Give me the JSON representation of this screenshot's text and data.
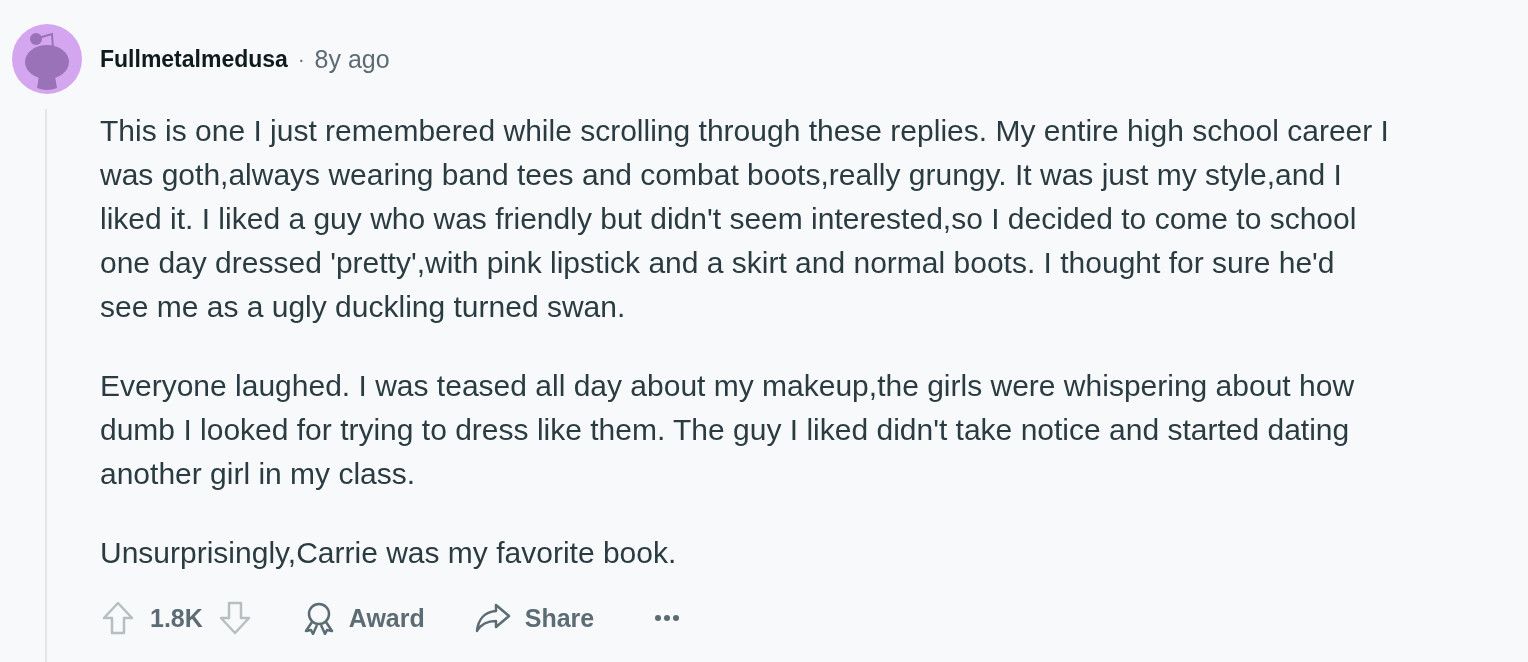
{
  "comment": {
    "author": "Fullmetalmedusa",
    "separator": "·",
    "age": "8y ago",
    "paragraphs": [
      "This is one I just remembered while scrolling through these replies. My entire high school career I was goth,always wearing band tees and combat boots,really grungy. It was just my style,and I liked it. I liked a guy who was friendly but didn't seem interested,so I decided to come to school one day dressed 'pretty',with pink lipstick and a skirt and normal boots. I thought for sure he'd see me as a ugly duckling turned swan.",
      "Everyone laughed. I was teased all day about my makeup,the girls were whispering about how dumb I looked for trying to dress like them. The guy I liked didn't take notice and started dating another girl in my class.",
      "Unsurprisingly,Carrie was my favorite book."
    ],
    "actions": {
      "score": "1.8K",
      "award": "Award",
      "share": "Share"
    }
  }
}
